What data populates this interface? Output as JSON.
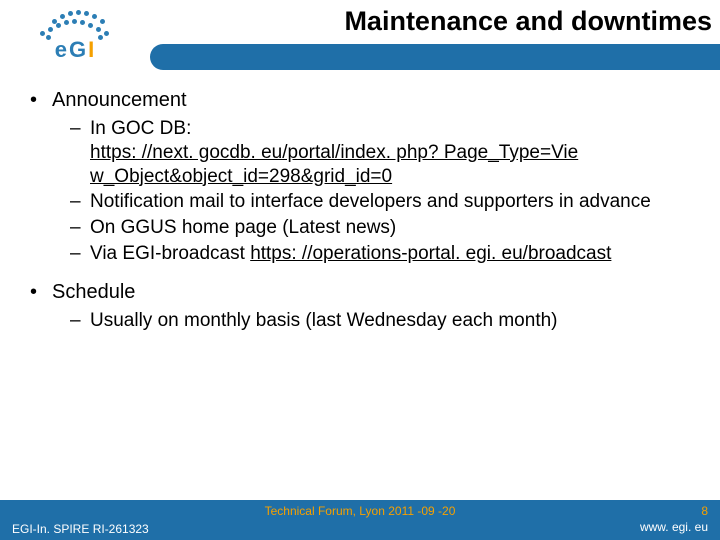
{
  "header": {
    "title": "Maintenance and downtimes",
    "logo": {
      "e": "e",
      "g": "G",
      "i": "I"
    }
  },
  "content": {
    "b1": "Announcement",
    "s1_pre": "In GOC DB: ",
    "s1_link": "https: //next. gocdb. eu/portal/index. php? Page_Type=Vie w_Object&object_id=298&grid_id=0",
    "s2": "Notification mail to interface developers and supporters in advance",
    "s3": "On GGUS home page (Latest news)",
    "s4_pre": "Via EGI-broadcast ",
    "s4_link": "https: //operations-portal. egi. eu/broadcast",
    "b2": "Schedule",
    "s5": "Usually on monthly basis (last Wednesday each month)"
  },
  "footer": {
    "left": "EGI-In. SPIRE RI-261323",
    "center": "Technical Forum, Lyon 2011 -09 -20",
    "page": "8",
    "url": "www. egi. eu"
  }
}
